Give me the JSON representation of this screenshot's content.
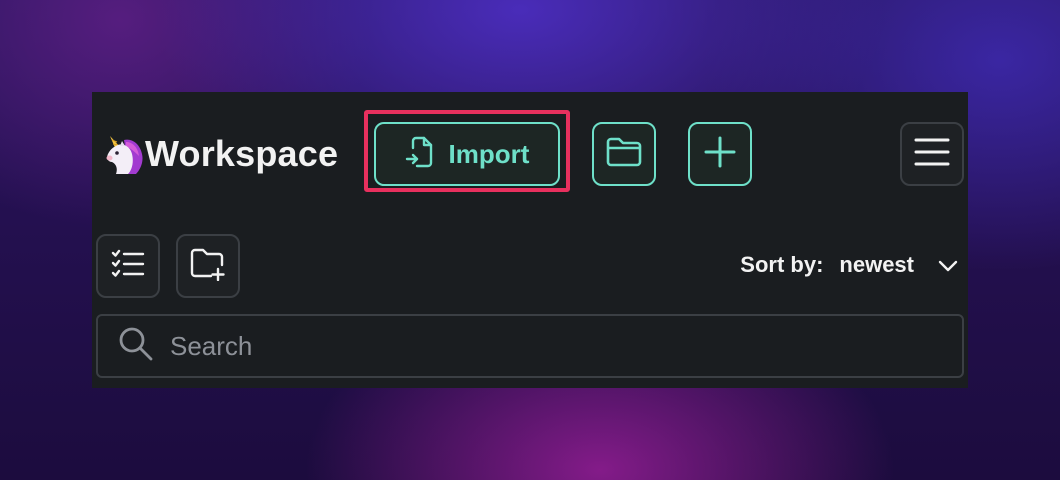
{
  "header": {
    "title": "Workspace",
    "import_label": "Import"
  },
  "toolbar": {
    "sort_label": "Sort by:",
    "sort_value": "newest"
  },
  "search": {
    "placeholder": "Search",
    "value": ""
  },
  "icons": {
    "logo": "unicorn-icon",
    "import": "file-import-icon",
    "folder": "folder-icon",
    "add": "plus-icon",
    "menu": "hamburger-menu-icon",
    "checklist": "checklist-icon",
    "new_folder": "folder-plus-icon",
    "sort_toggle": "chevron-down-icon",
    "search": "search-icon"
  },
  "colors": {
    "accent": "#6ee0c9",
    "highlight": "#e8305e",
    "panel_bg": "#1a1d20"
  }
}
